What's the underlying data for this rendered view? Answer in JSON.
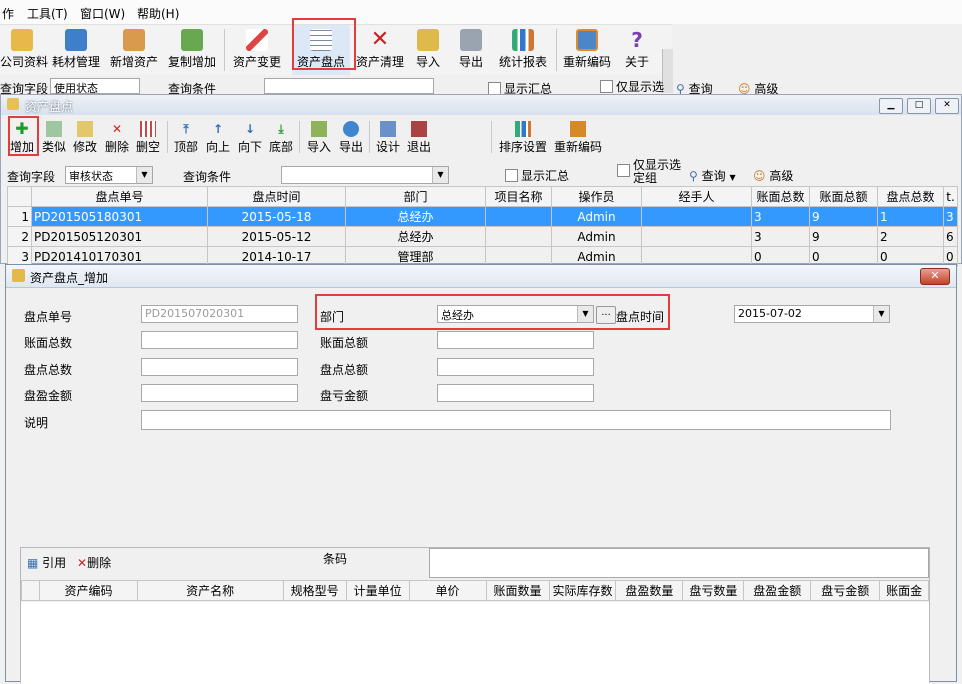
{
  "menubar": {
    "items": [
      "作",
      "工具(T)",
      "窗口(W)",
      "帮助(H)"
    ]
  },
  "main_toolbar": {
    "buttons": [
      "公司资料",
      "耗材管理",
      "新增资产",
      "复制增加",
      "资产变更",
      "资产盘点",
      "资产清理",
      "导入",
      "导出",
      "统计报表",
      "重新编码",
      "关于"
    ]
  },
  "bg_query": {
    "field_label": "查询字段",
    "field_value": "使用状态",
    "cond_label": "查询条件",
    "show_summary": "显示汇总",
    "only_selected": "仅显示选",
    "query": "查询",
    "advanced": "高级"
  },
  "inner_window": {
    "title": "资产盘点",
    "toolbar": [
      "增加",
      "类似",
      "修改",
      "删除",
      "删空",
      "顶部",
      "向上",
      "向下",
      "底部",
      "导入",
      "导出",
      "设计",
      "退出",
      "排序设置",
      "重新编码"
    ],
    "query_field_label": "查询字段",
    "query_field_value": "审核状态",
    "query_cond_label": "查询条件",
    "show_summary": "显示汇总",
    "only_selected_1": "仅显示选",
    "only_selected_2": "定组",
    "query": "查询",
    "advanced": "高级",
    "columns": [
      "盘点单号",
      "盘点时间",
      "部门",
      "项目名称",
      "操作员",
      "经手人",
      "账面总数",
      "账面总额",
      "盘点总数",
      "t."
    ],
    "rows": [
      {
        "num": "1",
        "id": "PD201505180301",
        "date": "2015-05-18",
        "dept": "总经办",
        "project": "",
        "operator": "Admin",
        "handler": "",
        "book_count": "3",
        "book_amount": "9",
        "check_count": "1",
        "extra": "3"
      },
      {
        "num": "2",
        "id": "PD201505120301",
        "date": "2015-05-12",
        "dept": "总经办",
        "project": "",
        "operator": "Admin",
        "handler": "",
        "book_count": "3",
        "book_amount": "9",
        "check_count": "2",
        "extra": "6"
      },
      {
        "num": "3",
        "id": "PD201410170301",
        "date": "2014-10-17",
        "dept": "管理部",
        "project": "",
        "operator": "Admin",
        "handler": "",
        "book_count": "0",
        "book_amount": "0",
        "check_count": "0",
        "extra": "0"
      }
    ]
  },
  "dialog": {
    "title": "资产盘点_增加",
    "fields": {
      "order_no_label": "盘点单号",
      "order_no_value": "PD201507020301",
      "dept_label": "部门",
      "dept_value": "总经办",
      "date_label": "盘点时间",
      "date_value": "2015-07-02",
      "book_count_label": "账面总数",
      "book_amount_label": "账面总额",
      "check_count_label": "盘点总数",
      "check_amount_label": "盘点总额",
      "surplus_label": "盘盈金额",
      "loss_label": "盘亏金额",
      "note_label": "说明",
      "browse": "..."
    },
    "detail": {
      "ref_button": "引用",
      "delete_button": "删除",
      "barcode_label": "条码",
      "columns": [
        "资产编码",
        "资产名称",
        "规格型号",
        "计量单位",
        "单价",
        "账面数量",
        "实际库存数",
        "盘盈数量",
        "盘亏数量",
        "盘盈金额",
        "盘亏金额",
        "账面金"
      ]
    }
  },
  "colors": {
    "selected_row": "#3399ff",
    "highlight": "#e23c3c",
    "close": "#c4412a"
  }
}
